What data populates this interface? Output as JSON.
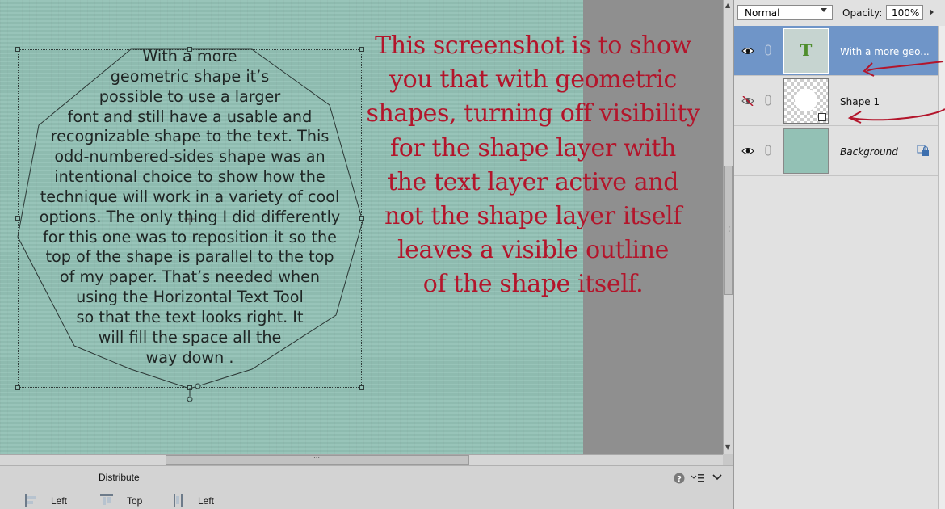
{
  "canvas": {
    "shape_text_lines": [
      "With a more",
      "geometric shape it’s",
      "possible to use a larger",
      "font and still have a usable and",
      "recognizable shape to the text. This",
      "odd-numbered-sides shape was an",
      "intentional choice to show how the",
      "technique will work in a variety of cool",
      "options. The only thing I did differently",
      "for this one was to reposition it so the",
      "top of the shape is parallel to the top",
      "of my paper. That’s needed when",
      "using the Horizontal Text Tool",
      "so that the text looks right. It",
      "will fill the space all the",
      "way down ."
    ],
    "annotation_lines": [
      "This screenshot is to show",
      "you that with geometric",
      "shapes, turning off visibility",
      "for the shape layer with",
      "the text layer active and",
      "not the shape layer itself",
      "leaves a visible outline",
      "of the shape itself."
    ],
    "paper_color": "#93c1b5",
    "annotation_color": "#b3152b",
    "arrow_color": "#b3152b"
  },
  "options_bar": {
    "group_label": "Distribute",
    "buttons": [
      {
        "label": "Left",
        "icon": "distribute-left-icon"
      },
      {
        "label": "Top",
        "icon": "distribute-top-icon"
      },
      {
        "label": "Left",
        "icon": "distribute-horizontal-left-icon"
      }
    ],
    "help_icon": "help-icon",
    "menu_icon": "panel-menu-icon",
    "collapse_icon": "chevron-down-icon"
  },
  "layers_panel": {
    "blend_mode": "Normal",
    "opacity_label": "Opacity:",
    "opacity_value": "100%",
    "layers": [
      {
        "name": "With a more geo...",
        "kind": "text",
        "visible": true,
        "active": true,
        "thumb_glyph": "T"
      },
      {
        "name": "Shape 1",
        "kind": "shape",
        "visible": false,
        "active": false
      },
      {
        "name": "Background",
        "kind": "background",
        "visible": true,
        "active": false,
        "locked": true
      }
    ],
    "active_color": "#6f95c8"
  }
}
